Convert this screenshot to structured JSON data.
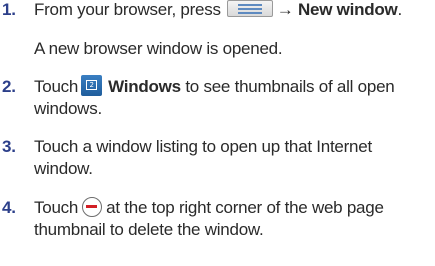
{
  "steps": [
    {
      "number": "1.",
      "before": "From your browser, press",
      "icon": "menu-key-icon",
      "after": "→",
      "bold": "New window",
      "end": "."
    },
    {
      "result": "A new browser window is opened."
    },
    {
      "number": "2.",
      "before": "Touch",
      "icon": "windows-icon",
      "icon_text": "2",
      "bold": "Windows",
      "after": "to see thumbnails of all open",
      "line2": "windows."
    },
    {
      "number": "3.",
      "line1": "Touch a window listing to open up that Internet",
      "line2": "window."
    },
    {
      "number": "4.",
      "before": "Touch",
      "icon": "remove-circle-icon",
      "after": "at the top right corner of the web page",
      "line2": "thumbnail to delete the window."
    }
  ],
  "colors": {
    "step_number": "#2c3f8a",
    "text": "#2a2a2a",
    "windows_icon": "#2a6fb4",
    "remove_icon": "#d21f25"
  }
}
